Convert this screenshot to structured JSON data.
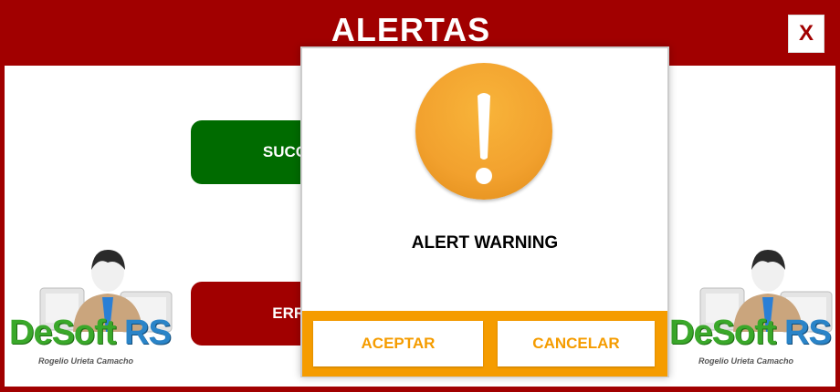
{
  "window": {
    "title": "ALERTAS",
    "close_label": "X"
  },
  "buttons": {
    "success_label": "SUCCESS",
    "error_label": "ERROR"
  },
  "logo": {
    "brand_part1": "DeSoft",
    "brand_part2": "RS",
    "subtitle": "Rogelio Urieta Camacho"
  },
  "modal": {
    "icon": "exclamation-warning-icon",
    "title": "ALERT WARNING",
    "accept_label": "ACEPTAR",
    "cancel_label": "CANCELAR"
  },
  "colors": {
    "header": "#a10000",
    "success": "#006b00",
    "error": "#a10000",
    "warning": "#f59c00"
  }
}
